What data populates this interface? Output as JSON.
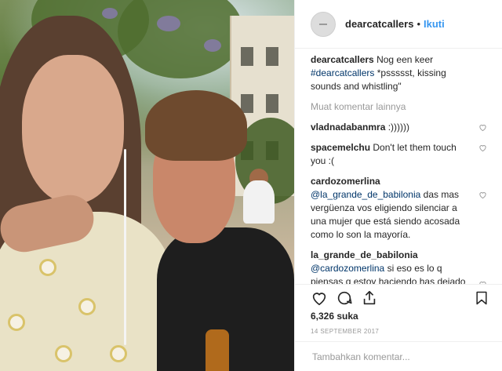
{
  "post": {
    "username": "dearcatcallers",
    "follow_label": "Ikuti",
    "separator": "•",
    "caption": {
      "username": "dearcatcallers",
      "text_1": "Nog een keer",
      "hashtag": "#dearcatcallers",
      "text_2": "*pssssst, kissing sounds and whistling\""
    },
    "load_more": "Muat komentar lainnya",
    "comments": [
      {
        "user": "vladnadabanmra",
        "text": ":))))))"
      },
      {
        "user": "spacemelchu",
        "text": "Don't let them touch you :("
      },
      {
        "user": "cardozomerlina",
        "mention": "@la_grande_de_babilonia",
        "text": "das mas vergüenza vos eligiendo silenciar a una mujer que está siendo acosada como lo son la mayoría."
      },
      {
        "user": "la_grande_de_babilonia",
        "mention": "@cardozomerlina",
        "text": "si eso es lo q piensas q estoy haciendo has dejado muy claro tu Nivel intelectual, lee e informate un pokito mas q pareceis papagayos q solo saben repetir lo q ven en la tele, un pogito d pensamiento critico xfavor"
      }
    ],
    "likes": "6,326 suka",
    "date": "14 SEPTEMBER 2017",
    "comment_placeholder": "Tambahkan komentar...",
    "icons": {
      "like": "heart-icon",
      "comment": "comment-bubble-icon",
      "share": "share-icon",
      "save": "bookmark-icon"
    },
    "colors": {
      "link": "#3897f0",
      "mention": "#003569",
      "muted": "#999999"
    }
  }
}
